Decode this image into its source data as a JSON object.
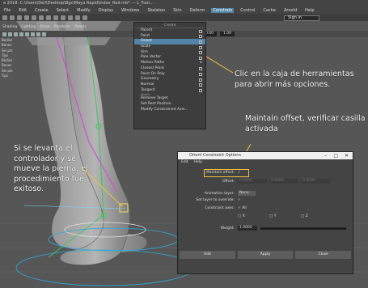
{
  "app": {
    "title": "a 2018: C:\\Users\\Dell\\Desktop\\Bgc\\Maya Rapid\\Index_Rod.mb* --- L_Foot..."
  },
  "menubar": {
    "items": [
      "File",
      "Edit",
      "Create",
      "Select",
      "Modify",
      "Display",
      "Windows",
      "Skeleton",
      "Skin",
      "Deform",
      "Constrain",
      "Control",
      "Cache",
      "Arnold",
      "Help"
    ],
    "active": "Constrain"
  },
  "toolbar": {
    "signin_label": "Sign in"
  },
  "viewport": {
    "menu": [
      "Shading",
      "Lighting",
      "Show",
      "Renderer",
      "Panels"
    ],
    "field_a": "0.00",
    "field_b": "1.00"
  },
  "leftlist": [
    "Bodies",
    "Bones",
    "Sel pts",
    "Tips",
    "Bodies",
    "Bones",
    "Sel pts",
    "Tips"
  ],
  "constrain_menu": {
    "title": "Create",
    "items": [
      {
        "label": "Parent",
        "box": true,
        "selected": false
      },
      {
        "label": "Point",
        "box": true,
        "selected": false
      },
      {
        "label": "Orient",
        "box": true,
        "selected": true
      },
      {
        "label": "Scale",
        "box": true,
        "selected": false
      },
      {
        "label": "Aim",
        "box": true,
        "selected": false
      },
      {
        "label": "Pole Vector",
        "box": true,
        "selected": false
      }
    ],
    "items2": [
      {
        "label": "Motion Paths",
        "arrow": true
      },
      {
        "label": "Closest Point",
        "box": true
      },
      {
        "label": "Point On Poly",
        "box": true
      },
      {
        "label": "Geometry",
        "box": true
      },
      {
        "label": "Normal",
        "box": true
      },
      {
        "label": "Tangent",
        "box": true
      }
    ],
    "section": "Modify",
    "items3": [
      {
        "label": "Remove Target"
      },
      {
        "label": "Set Rest Position"
      },
      {
        "label": "Modify Constrained Axis..."
      }
    ]
  },
  "annotations": {
    "tooltip_note": "Clic en la caja de herramientas para abrir más opciones.",
    "offset_note": "Maintain offset, verificar casilla activada",
    "result_note": "Si se levanta el controlador y se mueve la pierna, el procedimiento fue exitoso."
  },
  "dialog": {
    "title": "Orient Constraint Options",
    "menu": [
      "Edit",
      "Help"
    ],
    "maintain_offset_label": "Maintain offset:",
    "maintain_offset_value": "✓",
    "offset_label": "Offset:",
    "offset_values": [
      "0.0000",
      "0.0000",
      "0.0000"
    ],
    "anim_layer_label": "Animation layer:",
    "anim_layer_value": "None",
    "set_layer_label": "Set layer to override:",
    "set_layer_value": "✓",
    "constraint_axes_label": "Constraint axes:",
    "all_label": "All",
    "axes": [
      "X",
      "Y",
      "Z"
    ],
    "weight_label": "Weight:",
    "weight_value": "1.0000",
    "buttons": [
      "Add",
      "Apply",
      "Close"
    ]
  },
  "colors": {
    "accent": "#5285a6",
    "highlight": "#f0c040",
    "annotation_line": "#f0c040"
  }
}
